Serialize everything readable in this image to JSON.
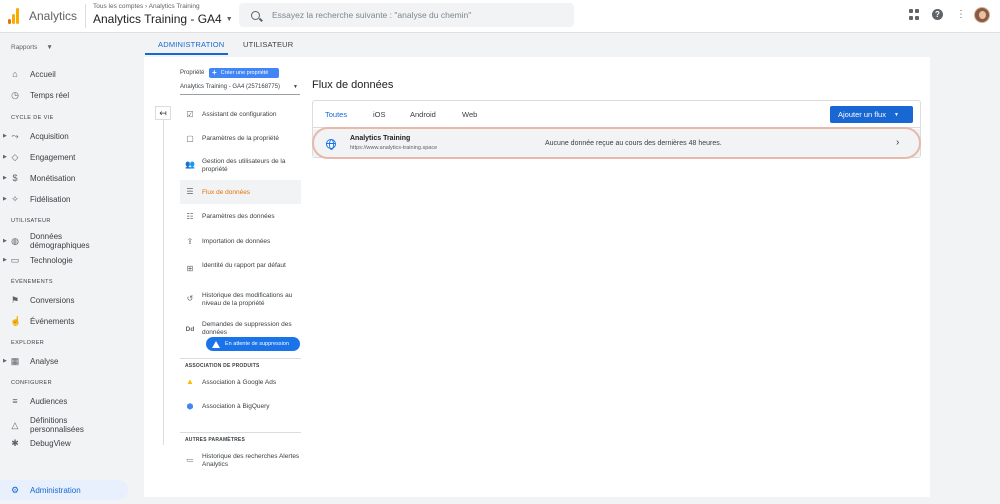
{
  "header": {
    "app_name": "Analytics",
    "breadcrumb": "Tous les comptes › Analytics Training",
    "property_title": "Analytics Training - GA4",
    "search_placeholder": "Essayez la recherche suivante : \"analyse du chemin\""
  },
  "sidebar": {
    "reports_label": "Rapports",
    "sections": {
      "lifecycle": "CYCLE DE VIE",
      "user": "UTILISATEUR",
      "events": "ÉVÉNEMENTS",
      "explore": "EXPLORER",
      "configure": "CONFIGURER"
    },
    "items": {
      "home": "Accueil",
      "realtime": "Temps réel",
      "acquisition": "Acquisition",
      "engagement": "Engagement",
      "monetization": "Monétisation",
      "retention": "Fidélisation",
      "demographics": "Données démographiques",
      "technology": "Technologie",
      "conversions": "Conversions",
      "events": "Événements",
      "analysis": "Analyse",
      "audiences": "Audiences",
      "custom_definitions": "Définitions personnalisées",
      "debugview": "DebugView",
      "admin": "Administration"
    }
  },
  "admin_tabs": {
    "administration": "ADMINISTRATION",
    "user": "UTILISATEUR"
  },
  "property_column": {
    "label": "Propriété",
    "create_button": "Créer une propriété",
    "selected_property": "Analytics Training - GA4 (257168775)",
    "items": {
      "setup_assistant": "Assistant de configuration",
      "property_settings": "Paramètres de la propriété",
      "user_management": "Gestion des utilisateurs de la propriété",
      "data_streams": "Flux de données",
      "data_settings": "Paramètres des données",
      "data_import": "Importation de données",
      "reporting_identity": "Identité du rapport par défaut",
      "change_history": "Historique des modifications au niveau de la propriété",
      "deletion_requests": "Demandes de suppression des données",
      "deletion_badge": "En attente de suppression",
      "google_ads": "Association à Google Ads",
      "bigquery": "Association à BigQuery",
      "search_history": "Historique des recherches Alertes Analytics"
    },
    "sections": {
      "product_links": "ASSOCIATION DE PRODUITS",
      "other_settings": "AUTRES PARAMÈTRES"
    }
  },
  "data_streams": {
    "title": "Flux de données",
    "tabs": [
      "Toutes",
      "iOS",
      "Android",
      "Web"
    ],
    "add_button": "Ajouter un flux",
    "stream": {
      "name": "Analytics Training",
      "url": "https://www.analytics-training.space",
      "status": "Aucune donnée reçue au cours des dernières 48 heures."
    }
  },
  "colors": {
    "accent": "#1967d2",
    "active_item": "#e8710a",
    "highlight_outline": "#e6b9aa"
  }
}
